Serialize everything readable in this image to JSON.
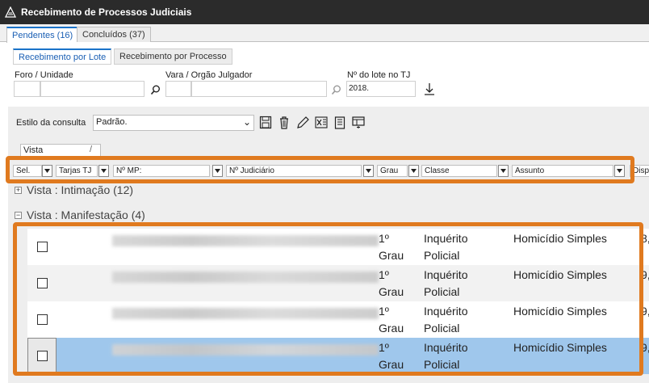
{
  "window": {
    "title": "Recebimento de Processos Judiciais"
  },
  "tabs": [
    {
      "label": "Pendentes (16)",
      "active": true
    },
    {
      "label": "Concluídos (37)",
      "active": false
    }
  ],
  "subtabs": [
    {
      "label": "Recebimento por Lote",
      "active": true
    },
    {
      "label": "Recebimento por Processo",
      "active": false
    }
  ],
  "filters": {
    "foro_label": "Foro / Unidade",
    "vara_label": "Vara / Orgão Julgador",
    "lote_label": "Nº do lote no TJ",
    "lote_value": "2018."
  },
  "query": {
    "style_label": "Estilo da consulta",
    "style_value": "Padrão."
  },
  "group_chip": "Vista",
  "columns": [
    "Sel.",
    "Tarjas TJ",
    "Nº MP:",
    "Nº Judiciário",
    "Grau",
    "Classe",
    "Assunto",
    "Disp"
  ],
  "groups": [
    {
      "label": "Vista : Intimação (12)",
      "expanded": false
    },
    {
      "label": "Vista : Manifestação (4)",
      "expanded": true
    }
  ],
  "rows": [
    {
      "grau_1": "1º",
      "grau_2": "Grau",
      "classe_1": "Inquérito",
      "classe_2": "Policial",
      "assunto": "Homicídio Simples",
      "disp": "8,"
    },
    {
      "grau_1": "1º",
      "grau_2": "Grau",
      "classe_1": "Inquérito",
      "classe_2": "Policial",
      "assunto": "Homicídio Simples",
      "disp": "9,"
    },
    {
      "grau_1": "1º",
      "grau_2": "Grau",
      "classe_1": "Inquérito",
      "classe_2": "Policial",
      "assunto": "Homicídio Simples",
      "disp": "9,"
    },
    {
      "grau_1": "1º",
      "grau_2": "Grau",
      "classe_1": "Inquérito",
      "classe_2": "Policial",
      "assunto": "Homicídio Simples",
      "disp": "9,"
    }
  ],
  "colors": {
    "accent": "#1a73c9",
    "highlight": "#e07a1f",
    "selected_row": "#9fc7ec"
  }
}
